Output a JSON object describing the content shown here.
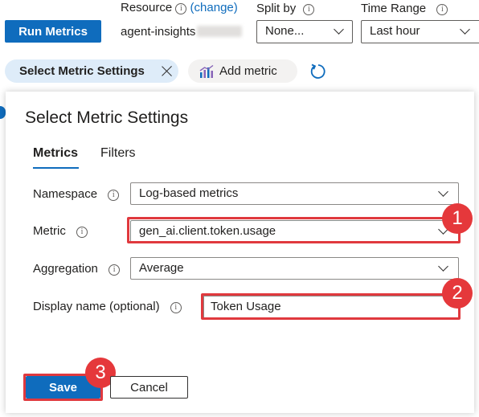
{
  "toolbar": {
    "run_label": "Run Metrics",
    "resource_label": "Resource",
    "change_link": "(change)",
    "resource_value": "agent-insights",
    "split_label": "Split by",
    "split_value": "None...",
    "time_label": "Time Range",
    "time_value": "Last hour"
  },
  "chips": {
    "active_label": "Select Metric Settings",
    "add_label": "Add metric"
  },
  "panel": {
    "title": "Select Metric Settings",
    "tabs": [
      {
        "label": "Metrics",
        "active": true
      },
      {
        "label": "Filters",
        "active": false
      }
    ],
    "namespace_label": "Namespace",
    "namespace_value": "Log-based metrics",
    "metric_label": "Metric",
    "metric_value": "gen_ai.client.token.usage",
    "aggregation_label": "Aggregation",
    "aggregation_value": "Average",
    "display_name_label": "Display name (optional)",
    "display_name_value": "Token Usage",
    "save_label": "Save",
    "cancel_label": "Cancel"
  },
  "badges": [
    "1",
    "2",
    "3"
  ],
  "colors": {
    "accent": "#0f6cbd",
    "highlight": "#e0393e",
    "chip_active_bg": "#deecf9"
  }
}
